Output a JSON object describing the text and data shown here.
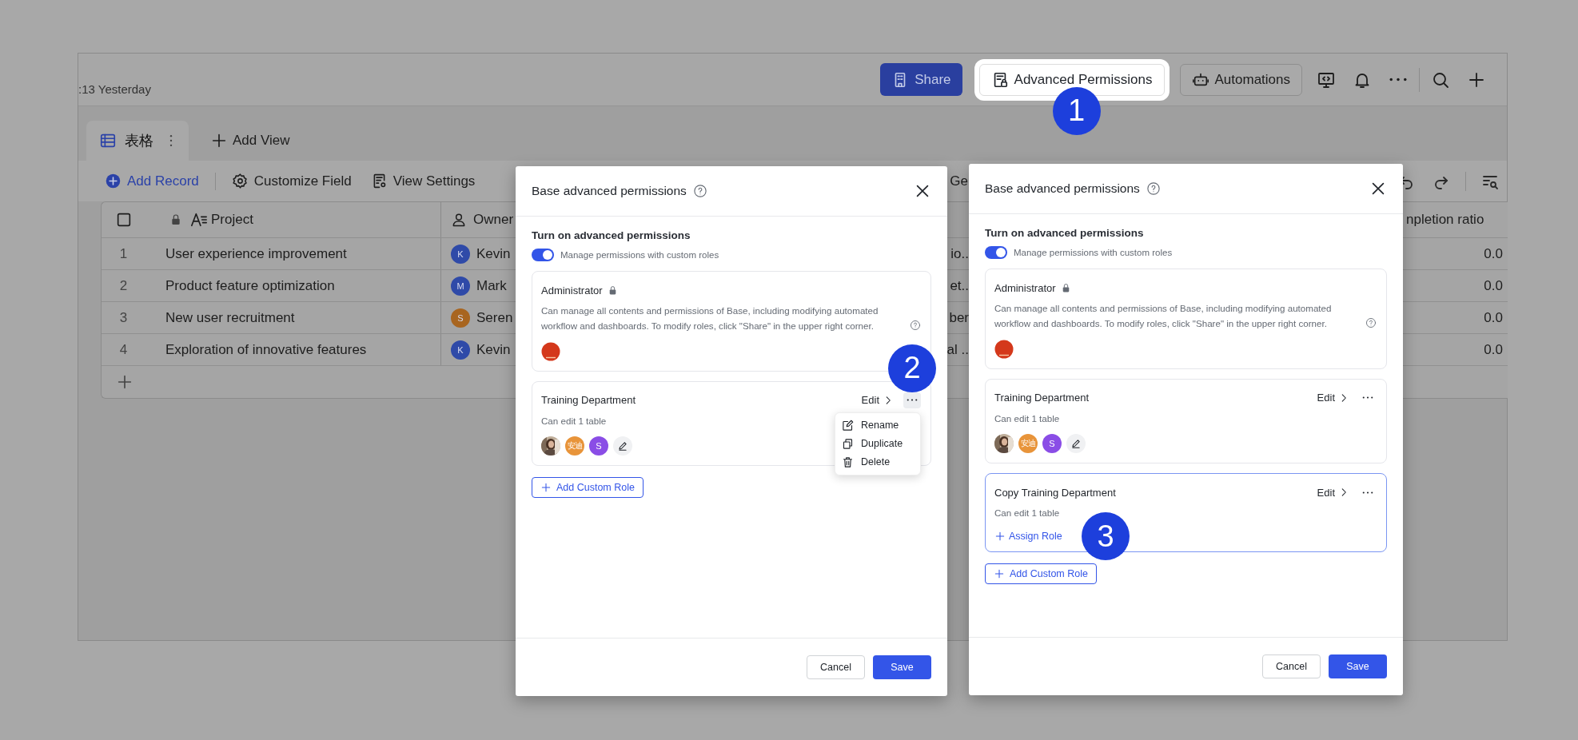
{
  "app": {
    "last_edited": ":13 Yesterday",
    "header_buttons": [
      {
        "kind": "primary",
        "label": "Share"
      },
      {
        "kind": "highlighted",
        "label": "Advanced Permissions",
        "callout": "1"
      },
      {
        "kind": "outline",
        "label": "Automations"
      }
    ],
    "views": [
      {
        "label": "表格",
        "selected": true
      }
    ],
    "add_view": "Add View",
    "toolbar": [
      {
        "kind": "add",
        "label": "Add Record"
      },
      {
        "kind": "gear",
        "label": "Customize Field"
      },
      {
        "kind": "view",
        "label": "View Settings"
      }
    ],
    "toolbar_fragment": "Ge",
    "table": {
      "select_all": {
        "checked": false
      },
      "columns": [
        {
          "kind": "project",
          "label": "Project"
        },
        {
          "kind": "owner",
          "label": "Owner"
        },
        {
          "kind": "column_3"
        },
        {
          "kind": "ratio",
          "label": "npletion ratio"
        }
      ],
      "rows": [
        {
          "number": "1",
          "project": "User experience improvement",
          "owner": {
            "name": "Kevin",
            "initial": "K",
            "color": "#2f4aa8"
          },
          "column_3": "io..",
          "ratio": "0.0"
        },
        {
          "number": "2",
          "project": "Product feature optimization",
          "owner": {
            "name": "Mark",
            "initial": "M",
            "color": "#2f4aa8"
          },
          "column_3": "et..",
          "ratio": "0.0"
        },
        {
          "number": "3",
          "project": "New user recruitment",
          "owner": {
            "name": "Seren",
            "initial": "S",
            "color": "#a8651f"
          },
          "column_3": "ber",
          "ratio": "0.0"
        },
        {
          "number": "4",
          "project": "Exploration of innovative features",
          "owner": {
            "name": "Kevin",
            "initial": "K",
            "color": "#2f4aa8"
          },
          "column_3": "al ..",
          "ratio": "0.0"
        }
      ]
    }
  },
  "dialogs": [
    {
      "title": "Base advanced permissions",
      "heading": "Turn on advanced permissions",
      "toggle": {
        "label": "Manage permissions with custom roles",
        "on": true
      },
      "roles": [
        {
          "kind": "admin",
          "name": "Administrator",
          "description": "Can manage all contents and permissions of Base, including modifying automated workflow and dashboards. To modify roles, click \"Share\" in the upper right corner.",
          "members": [
            {
              "kind": "avatar"
            }
          ]
        },
        {
          "kind": "custom",
          "name": "Training Department",
          "edit": "Edit",
          "description": "Can edit 1 table",
          "highlighted": false,
          "menu_open": true,
          "callout": "2",
          "menu": [
            {
              "kind": "rename",
              "label": "Rename"
            },
            {
              "kind": "duplicate",
              "label": "Duplicate"
            },
            {
              "kind": "delete",
              "label": "Delete"
            }
          ],
          "members": [
            {
              "kind": "picture"
            },
            {
              "kind": "initials",
              "text": "安迪",
              "color": "#e8943a"
            },
            {
              "kind": "initials",
              "text": "S",
              "color": "#8a4de6"
            },
            {
              "kind": "add"
            }
          ]
        }
      ],
      "add_role": "Add Custom Role",
      "buttons": [
        {
          "kind": "secondary",
          "label": "Cancel"
        },
        {
          "kind": "primary",
          "label": "Save"
        }
      ]
    },
    {
      "title": "Base advanced permissions",
      "heading": "Turn on advanced permissions",
      "toggle": {
        "label": "Manage permissions with custom roles",
        "on": true
      },
      "roles": [
        {
          "kind": "admin",
          "name": "Administrator",
          "description": "Can manage all contents and permissions of Base, including modifying automated workflow and dashboards. To modify roles, click \"Share\" in the upper right corner.",
          "members": [
            {
              "kind": "avatar"
            }
          ]
        },
        {
          "kind": "custom",
          "name": "Training Department",
          "edit": "Edit",
          "description": "Can edit 1 table",
          "highlighted": false,
          "menu_open": false,
          "members": [
            {
              "kind": "picture"
            },
            {
              "kind": "initials",
              "text": "安迪",
              "color": "#e8943a"
            },
            {
              "kind": "initials",
              "text": "S",
              "color": "#8a4de6"
            },
            {
              "kind": "add"
            }
          ]
        },
        {
          "kind": "custom",
          "name": "Copy Training Department",
          "edit": "Edit",
          "description": "Can edit 1 table",
          "highlighted": true,
          "menu_open": false,
          "callout": "3",
          "assign": "Assign Role"
        }
      ],
      "add_role": "Add Custom Role",
      "buttons": [
        {
          "kind": "secondary",
          "label": "Cancel"
        },
        {
          "kind": "primary",
          "label": "Save"
        }
      ]
    }
  ]
}
